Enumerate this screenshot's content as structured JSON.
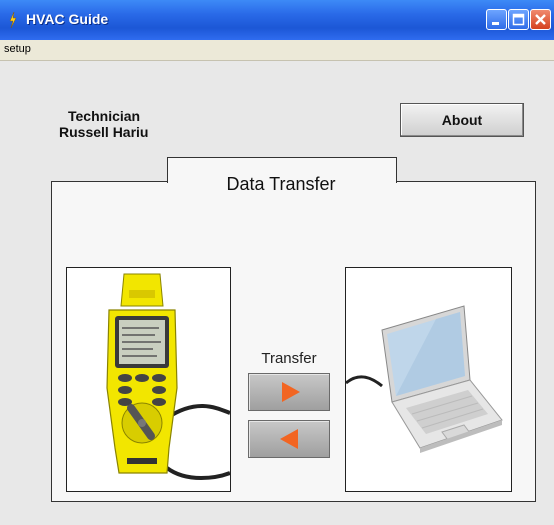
{
  "window": {
    "title": "HVAC Guide"
  },
  "menu": {
    "items": [
      "setup"
    ]
  },
  "technician": {
    "role": "Technician",
    "name": "Russell Hariu"
  },
  "about_button": {
    "label": "About"
  },
  "panel": {
    "title": "Data Transfer"
  },
  "transfer": {
    "label": "Transfer",
    "send_icon": "arrow-right-icon",
    "receive_icon": "arrow-left-icon"
  },
  "colors": {
    "arrow": "#f26522",
    "device_yellow": "#f2e600",
    "titlebar": "#1c57d6"
  }
}
